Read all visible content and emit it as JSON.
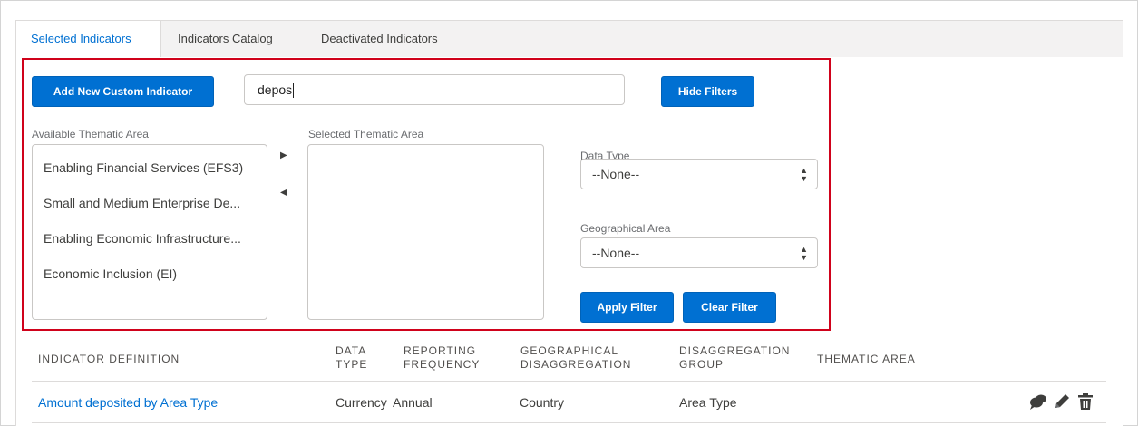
{
  "tabs": [
    {
      "label": "Selected Indicators",
      "active": true
    },
    {
      "label": "Indicators Catalog",
      "active": false
    },
    {
      "label": "Deactivated Indicators",
      "active": false
    }
  ],
  "buttons": {
    "add_custom": "Add New Custom Indicator",
    "hide_filters": "Hide Filters",
    "apply_filter": "Apply Filter",
    "clear_filter": "Clear Filter"
  },
  "search": {
    "value": "depos"
  },
  "available": {
    "label": "Available Thematic Area",
    "items": [
      "Enabling Financial Services (EFS3)",
      "Small and Medium Enterprise De...",
      "Enabling Economic Infrastructure...",
      "Economic Inclusion (EI)"
    ]
  },
  "selected": {
    "label": "Selected Thematic Area",
    "items": []
  },
  "data_type": {
    "label": "Data Type",
    "value": "--None--"
  },
  "geo_area": {
    "label": "Geographical Area",
    "value": "--None--"
  },
  "table": {
    "headers": [
      [
        "INDICATOR DEFINITION"
      ],
      [
        "DATA",
        "TYPE"
      ],
      [
        "REPORTING",
        "FREQUENCY"
      ],
      [
        "GEOGRAPHICAL",
        "DISAGGREGATION"
      ],
      [
        "DISAGGREGATION",
        "GROUP"
      ],
      [
        "THEMATIC AREA"
      ]
    ],
    "rows": [
      {
        "definition": "Amount deposited by Area Type",
        "data_type": "Currency",
        "frequency": "Annual",
        "geo_disaggregation": "Country",
        "group": "Area Type",
        "thematic_area": ""
      }
    ],
    "row_actions": [
      "chat-icon",
      "edit-pencil-icon",
      "delete-trash-icon"
    ]
  },
  "colors": {
    "brand": "#0070d2",
    "highlight_border": "#d0021b",
    "tab_bg": "#f3f2f2"
  }
}
